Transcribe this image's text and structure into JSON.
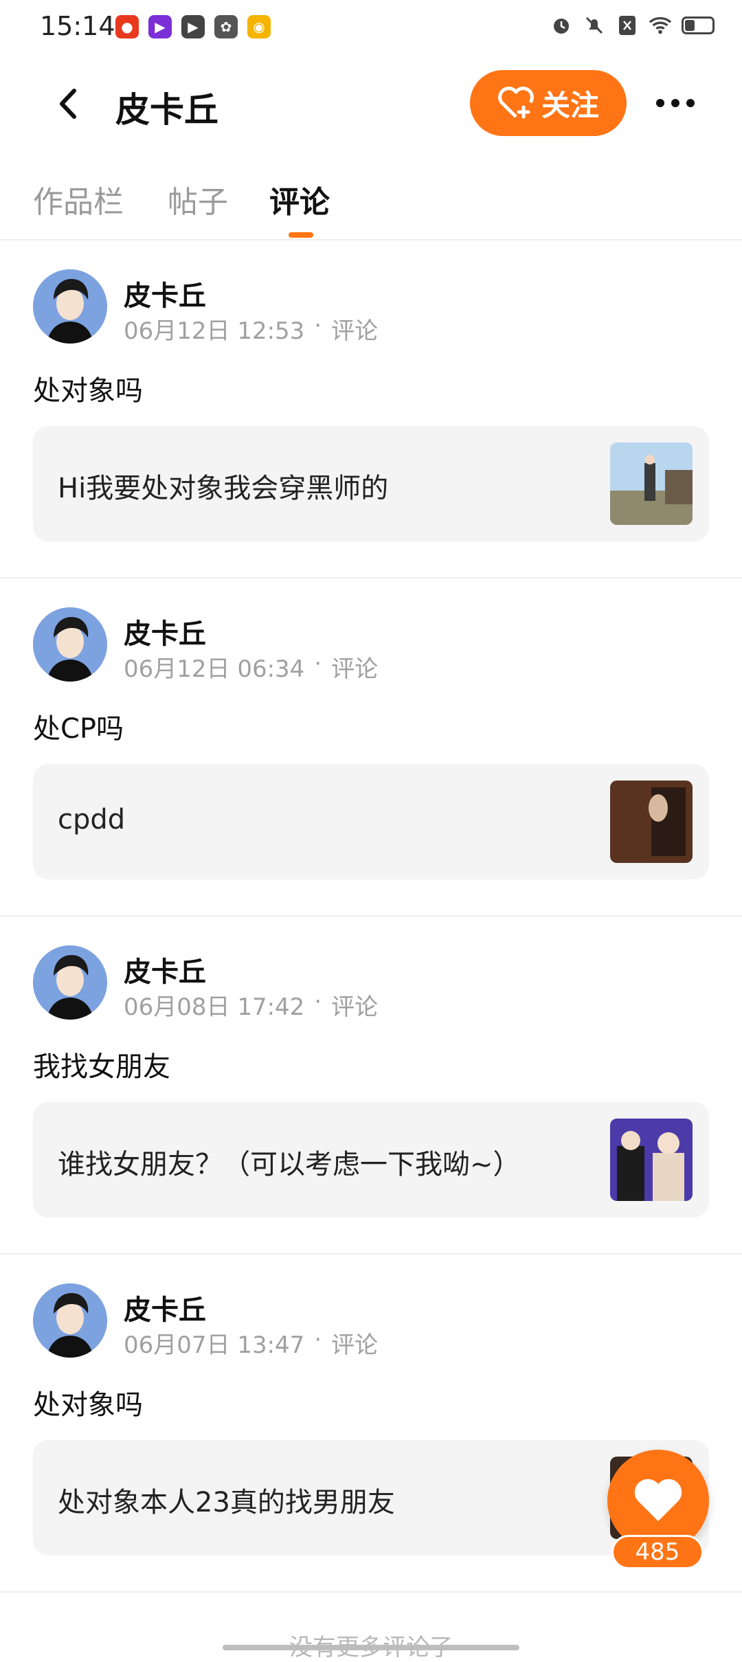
{
  "status_bar": {
    "time": "15:14",
    "app_icons": [
      "app-icon-1",
      "app-icon-2",
      "app-icon-3",
      "app-icon-4",
      "weibo-icon"
    ],
    "system_icons": [
      "alarm-icon",
      "mute-icon",
      "no-sim-icon",
      "wifi-icon",
      "battery-icon"
    ]
  },
  "header": {
    "title": "皮卡丘",
    "follow_label": "关注"
  },
  "tabs": [
    {
      "label": "作品栏",
      "active": false
    },
    {
      "label": "帖子",
      "active": false
    },
    {
      "label": "评论",
      "active": true
    }
  ],
  "comments": [
    {
      "name": "皮卡丘",
      "date": "06月12日 12:53",
      "sep": "·",
      "type": "评论",
      "title": "处对象吗",
      "quote": "Hi我要处对象我会穿黑师的"
    },
    {
      "name": "皮卡丘",
      "date": "06月12日 06:34",
      "sep": "·",
      "type": "评论",
      "title": "处CP吗",
      "quote": "cpdd"
    },
    {
      "name": "皮卡丘",
      "date": "06月08日 17:42",
      "sep": "·",
      "type": "评论",
      "title": "我找女朋友",
      "quote": "谁找女朋友？（可以考虑一下我呦~）"
    },
    {
      "name": "皮卡丘",
      "date": "06月07日 13:47",
      "sep": "·",
      "type": "评论",
      "title": "处对象吗",
      "quote": "处对象本人23真的找男朋友"
    }
  ],
  "like": {
    "count": "485"
  },
  "footer": {
    "no_more": "没有更多评论了"
  },
  "colors": {
    "accent": "#ff7414",
    "card_bg": "#f4f4f4",
    "muted": "#a0a0a0"
  }
}
